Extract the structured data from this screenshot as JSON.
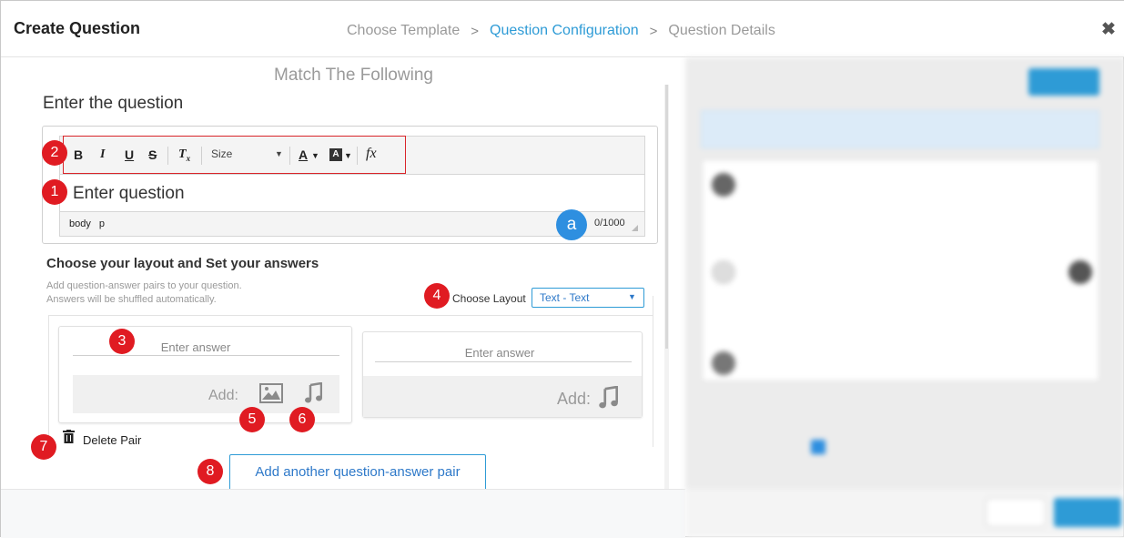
{
  "header": {
    "title": "Create Question",
    "breadcrumbs": [
      {
        "label": "Choose Template",
        "active": false
      },
      {
        "label": "Question Configuration",
        "active": true
      },
      {
        "label": "Question Details",
        "active": false
      }
    ],
    "separator": ">",
    "close_glyph": "✖"
  },
  "form": {
    "section_title": "Match The Following",
    "question_label": "Enter the question",
    "editor": {
      "toolbar": {
        "bold": "B",
        "italic": "I",
        "underline": "U",
        "strike": "S",
        "remove_format": "Tx",
        "size_label": "Size",
        "font_color": "A",
        "bg_color": "A",
        "formula": "fx"
      },
      "placeholder": "Enter question",
      "path": "body p",
      "char_count": "0/1000"
    },
    "layout_section": {
      "title": "Choose your layout and Set your answers",
      "hint_line1": "Add question-answer pairs to your question.",
      "hint_line2": "Answers will be shuffled automatically.",
      "layout_label": "Choose Layout",
      "layout_value": "Text - Text"
    },
    "pair": {
      "left_placeholder": "Enter answer",
      "right_placeholder": "Enter answer",
      "add_label": "Add:",
      "delete_label": "Delete Pair"
    },
    "add_pair_button": "Add another question-answer pair"
  },
  "markers": {
    "m1": "1",
    "m2": "2",
    "m3": "3",
    "m4": "4",
    "m5": "5",
    "m6": "6",
    "m7": "7",
    "m8": "8",
    "ma": "a"
  },
  "colors": {
    "accent": "#2e9bd6",
    "marker_red": "#e01b22",
    "badge_blue": "#2e8fe0"
  }
}
